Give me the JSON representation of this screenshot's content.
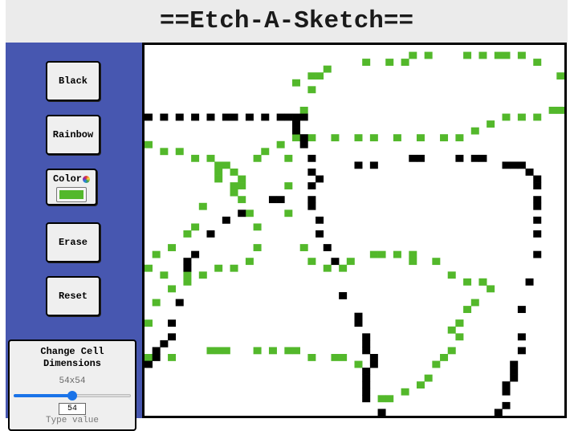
{
  "header": {
    "title": "==Etch-A-Sketch=="
  },
  "controls": {
    "black_label": "Black",
    "rainbow_label": "Rainbow",
    "color_label": "Color",
    "erase_label": "Erase",
    "reset_label": "Reset",
    "selected_color": "#53b82b"
  },
  "dimensions": {
    "title": "Change Cell Dimensions",
    "current": "54x54",
    "input_value": "54",
    "slider_fraction": 0.5,
    "hint": "Type value"
  },
  "grid": {
    "cells_per_side": 54,
    "black": "#000000",
    "green": "#53b82b",
    "green_strokes": [
      [
        [
          28,
          2
        ],
        [
          31,
          2
        ],
        [
          33,
          2
        ],
        [
          34,
          1
        ],
        [
          36,
          1
        ],
        [
          41,
          1
        ],
        [
          43,
          1
        ],
        [
          45,
          1
        ],
        [
          46,
          1
        ],
        [
          48,
          1
        ],
        [
          50,
          2
        ],
        [
          53,
          4
        ]
      ],
      [
        [
          19,
          5
        ],
        [
          21,
          4
        ],
        [
          23,
          3
        ],
        [
          22,
          4
        ],
        [
          21,
          6
        ],
        [
          20,
          9
        ],
        [
          19,
          13
        ],
        [
          21,
          13
        ],
        [
          24,
          13
        ],
        [
          27,
          13
        ],
        [
          29,
          13
        ],
        [
          32,
          13
        ],
        [
          35,
          13
        ],
        [
          38,
          13
        ],
        [
          40,
          13
        ],
        [
          42,
          12
        ],
        [
          44,
          11
        ],
        [
          46,
          10
        ],
        [
          48,
          10
        ],
        [
          50,
          10
        ],
        [
          52,
          9
        ],
        [
          53,
          9
        ]
      ],
      [
        [
          0,
          14
        ],
        [
          2,
          15
        ],
        [
          4,
          15
        ],
        [
          6,
          16
        ],
        [
          8,
          16
        ],
        [
          9,
          17
        ],
        [
          11,
          18
        ],
        [
          12,
          20
        ],
        [
          12,
          22
        ],
        [
          13,
          24
        ],
        [
          14,
          26
        ],
        [
          14,
          29
        ],
        [
          13,
          31
        ],
        [
          11,
          32
        ],
        [
          9,
          32
        ],
        [
          7,
          33
        ],
        [
          5,
          34
        ],
        [
          3,
          35
        ],
        [
          1,
          37
        ],
        [
          0,
          40
        ]
      ],
      [
        [
          14,
          16
        ],
        [
          15,
          15
        ],
        [
          17,
          14
        ]
      ],
      [
        [
          18,
          16
        ],
        [
          18,
          20
        ],
        [
          18,
          24
        ]
      ],
      [
        [
          9,
          18
        ],
        [
          9,
          19
        ],
        [
          10,
          17
        ]
      ],
      [
        [
          12,
          19
        ],
        [
          11,
          20
        ],
        [
          11,
          21
        ]
      ],
      [
        [
          7,
          23
        ],
        [
          6,
          26
        ],
        [
          5,
          27
        ],
        [
          3,
          29
        ],
        [
          1,
          30
        ],
        [
          0,
          32
        ]
      ],
      [
        [
          2,
          33
        ],
        [
          5,
          33
        ]
      ],
      [
        [
          20,
          29
        ],
        [
          21,
          31
        ],
        [
          23,
          32
        ],
        [
          25,
          32
        ],
        [
          26,
          31
        ]
      ],
      [
        [
          29,
          30
        ],
        [
          30,
          30
        ],
        [
          32,
          30
        ],
        [
          34,
          30
        ]
      ],
      [
        [
          34,
          31
        ],
        [
          37,
          31
        ],
        [
          39,
          33
        ],
        [
          41,
          34
        ],
        [
          43,
          34
        ],
        [
          44,
          35
        ]
      ],
      [
        [
          43,
          34
        ],
        [
          42,
          37
        ],
        [
          41,
          38
        ],
        [
          40,
          40
        ]
      ],
      [
        [
          40,
          40
        ],
        [
          39,
          41
        ],
        [
          40,
          42
        ],
        [
          39,
          44
        ]
      ],
      [
        [
          38,
          45
        ],
        [
          37,
          46
        ],
        [
          36,
          48
        ],
        [
          35,
          49
        ],
        [
          33,
          50
        ],
        [
          31,
          51
        ],
        [
          30,
          51
        ]
      ],
      [
        [
          8,
          44
        ],
        [
          9,
          44
        ],
        [
          10,
          44
        ],
        [
          14,
          44
        ],
        [
          16,
          44
        ],
        [
          18,
          44
        ],
        [
          19,
          44
        ],
        [
          21,
          45
        ],
        [
          24,
          45
        ],
        [
          25,
          45
        ],
        [
          27,
          46
        ]
      ],
      [
        [
          0,
          45
        ],
        [
          3,
          45
        ]
      ]
    ],
    "black_strokes": [
      [
        [
          0,
          10
        ],
        [
          2,
          10
        ],
        [
          4,
          10
        ],
        [
          6,
          10
        ],
        [
          8,
          10
        ],
        [
          10,
          10
        ],
        [
          11,
          10
        ],
        [
          13,
          10
        ],
        [
          15,
          10
        ],
        [
          17,
          10
        ],
        [
          18,
          10
        ],
        [
          19,
          10
        ],
        [
          20,
          10
        ],
        [
          19,
          11
        ],
        [
          19,
          12
        ],
        [
          20,
          13
        ],
        [
          20,
          14
        ]
      ],
      [
        [
          21,
          16
        ],
        [
          21,
          18
        ],
        [
          21,
          20
        ],
        [
          21,
          22
        ]
      ],
      [
        [
          22,
          19
        ]
      ],
      [
        [
          16,
          22
        ],
        [
          17,
          22
        ]
      ],
      [
        [
          21,
          23
        ],
        [
          22,
          25
        ],
        [
          22,
          27
        ],
        [
          23,
          29
        ]
      ],
      [
        [
          12,
          24
        ],
        [
          10,
          25
        ],
        [
          8,
          27
        ]
      ],
      [
        [
          6,
          30
        ],
        [
          5,
          31
        ],
        [
          5,
          32
        ]
      ],
      [
        [
          24,
          31
        ]
      ],
      [
        [
          27,
          17
        ],
        [
          29,
          17
        ]
      ],
      [
        [
          34,
          16
        ],
        [
          35,
          16
        ],
        [
          40,
          16
        ],
        [
          42,
          16
        ],
        [
          43,
          16
        ]
      ],
      [
        [
          46,
          17
        ],
        [
          47,
          17
        ],
        [
          48,
          17
        ],
        [
          49,
          18
        ],
        [
          50,
          19
        ],
        [
          50,
          20
        ],
        [
          50,
          22
        ]
      ],
      [
        [
          50,
          23
        ],
        [
          50,
          25
        ],
        [
          50,
          27
        ]
      ],
      [
        [
          50,
          30
        ]
      ],
      [
        [
          49,
          34
        ]
      ],
      [
        [
          48,
          38
        ]
      ],
      [
        [
          48,
          42
        ],
        [
          48,
          44
        ]
      ],
      [
        [
          47,
          46
        ],
        [
          47,
          47
        ],
        [
          47,
          48
        ]
      ],
      [
        [
          46,
          49
        ],
        [
          46,
          50
        ],
        [
          46,
          52
        ],
        [
          45,
          53
        ]
      ],
      [
        [
          25,
          36
        ]
      ],
      [
        [
          27,
          39
        ],
        [
          27,
          40
        ],
        [
          28,
          42
        ],
        [
          28,
          43
        ],
        [
          28,
          44
        ],
        [
          29,
          45
        ],
        [
          29,
          46
        ],
        [
          28,
          47
        ],
        [
          28,
          48
        ],
        [
          28,
          49
        ],
        [
          28,
          50
        ],
        [
          28,
          51
        ],
        [
          30,
          53
        ]
      ],
      [
        [
          4,
          37
        ]
      ],
      [
        [
          3,
          40
        ]
      ],
      [
        [
          3,
          42
        ],
        [
          2,
          43
        ],
        [
          1,
          44
        ],
        [
          1,
          45
        ],
        [
          0,
          46
        ]
      ]
    ]
  }
}
